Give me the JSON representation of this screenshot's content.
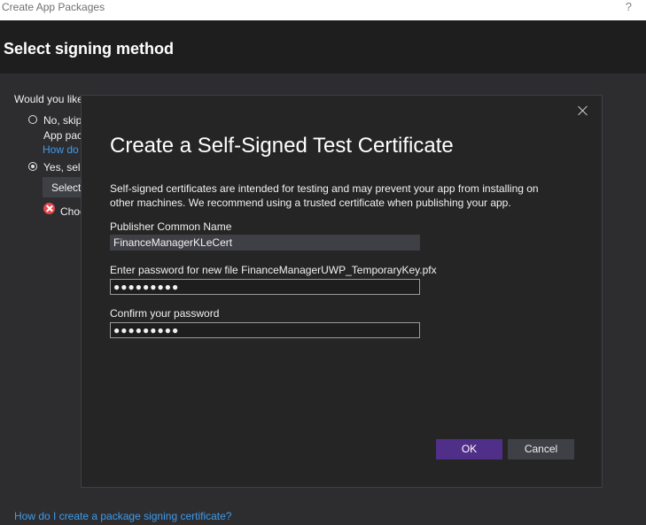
{
  "window": {
    "title": "Create App Packages",
    "help": "?"
  },
  "header": {
    "title": "Select signing method"
  },
  "background": {
    "question": "Would you like",
    "option_no": "No, skip",
    "option_no_line2": "App pac",
    "option_no_link": "How do",
    "option_yes": "Yes, sele",
    "select_button": "Select",
    "error_text": "Choo",
    "footer_link": "How do I create a package signing certificate?"
  },
  "dialog": {
    "title": "Create a Self-Signed Test Certificate",
    "description": "Self-signed certificates are intended for testing and may prevent your app from installing on other machines. We recommend using a trusted certificate when publishing your app.",
    "publisher_label": "Publisher Common Name",
    "publisher_value": "FinanceManagerKLeCert",
    "password_label": "Enter password for new file FinanceManagerUWP_TemporaryKey.pfx",
    "password_value": "●●●●●●●●●",
    "confirm_label": "Confirm your password",
    "confirm_value": "●●●●●●●●●",
    "ok_label": "OK",
    "cancel_label": "Cancel"
  },
  "colors": {
    "accent": "#4f2f87",
    "link": "#3f9bea",
    "error": "#e5484d"
  }
}
